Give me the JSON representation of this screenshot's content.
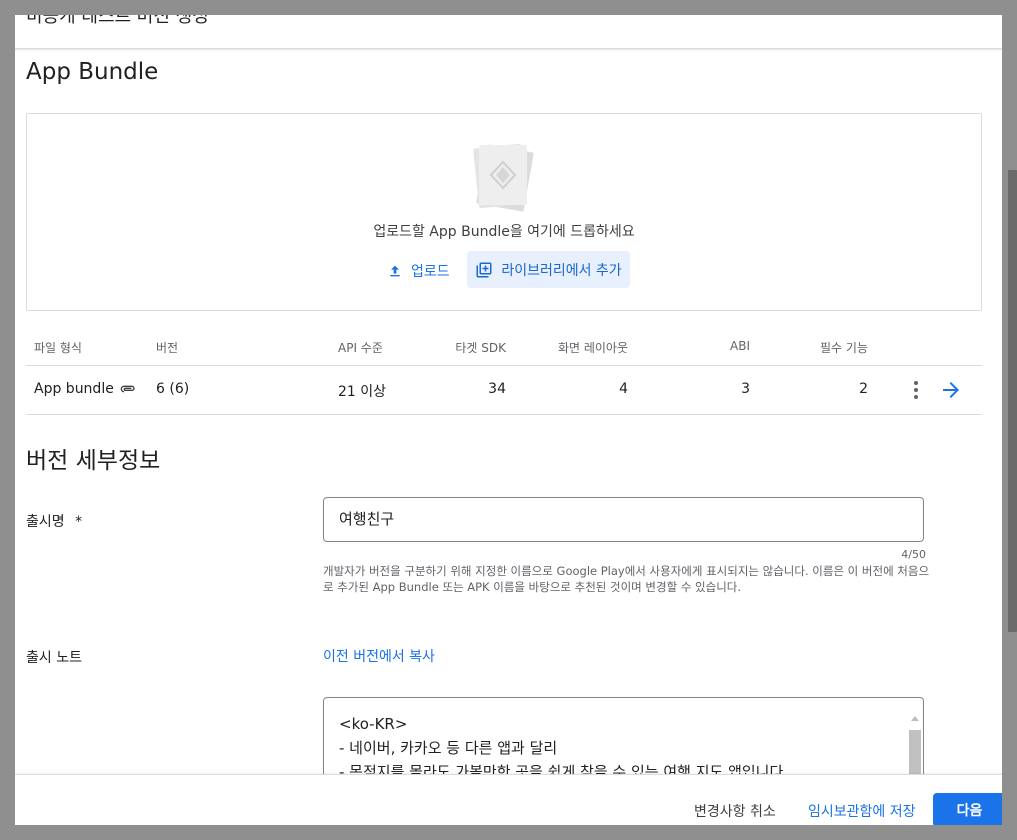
{
  "dialog": {
    "title": "비공개 테스트 버전 생성"
  },
  "app_bundle": {
    "section_title": "App Bundle",
    "drop_text": "업로드할 App Bundle을 여기에 드롭하세요",
    "upload_label": "업로드",
    "library_label": "라이브러리에서 추가"
  },
  "table": {
    "headers": {
      "file_type": "파일 형식",
      "version": "버전",
      "api_level": "API 수준",
      "target_sdk": "타겟 SDK",
      "screen_layout": "화면 레이아웃",
      "abi": "ABI",
      "required_features": "필수 기능"
    },
    "rows": [
      {
        "file_type": "App bundle",
        "version": "6 (6)",
        "api_level": "21 이상",
        "target_sdk": "34",
        "screen_layout": "4",
        "abi": "3",
        "required_features": "2"
      }
    ]
  },
  "details": {
    "section_title": "버전 세부정보",
    "release_name_label": "출시명",
    "required_mark": "*",
    "release_name_value": "여행친구",
    "counter": "4/50",
    "helper_text": "개발자가 버전을 구분하기 위해 지정한 이름으로 Google Play에서 사용자에게 표시되지는 않습니다. 이름은 이 버전에 처음으로 추가된 App Bundle 또는 APK 이름을 바탕으로 추천된 것이며 변경할 수 있습니다.",
    "release_notes_label": "출시 노트",
    "copy_link": "이전 버전에서 복사",
    "notes_lines": [
      "<ko-KR>",
      "- 네이버, 카카오 등 다른 앱과 달리",
      "- 목적지를 몰라도 가볼만한 곳을 쉽게 찾을 수 있는 여행 지도 앱입니다"
    ]
  },
  "footer": {
    "cancel_label": "변경사항 취소",
    "save_label": "임시보관함에 저장",
    "next_label": "다음"
  },
  "colors": {
    "accent": "#1a73e8",
    "library_bg": "#e8f0fe",
    "overlay": "#8f8f8f"
  },
  "icons": {
    "upload": "upload-icon",
    "library": "library-add-icon",
    "file": "attachment-icon",
    "more": "more-vert-icon",
    "arrow": "arrow-forward-icon"
  }
}
